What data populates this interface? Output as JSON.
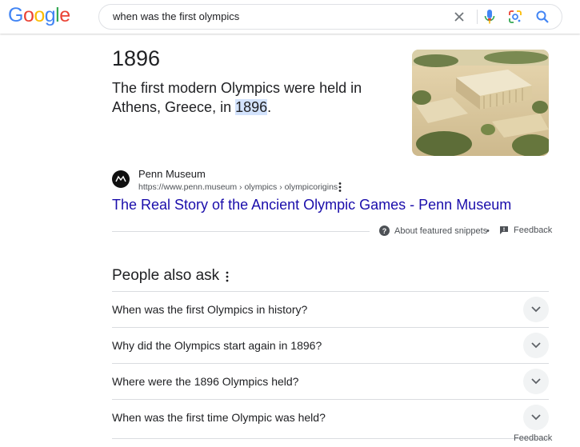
{
  "logo": {
    "letters": [
      "G",
      "o",
      "o",
      "g",
      "l",
      "e"
    ],
    "colors": [
      "#4285F4",
      "#EA4335",
      "#FBBC05",
      "#4285F4",
      "#34A853",
      "#EA4335"
    ]
  },
  "search": {
    "query": "when was the first olympics"
  },
  "featured": {
    "answer": "1896",
    "snippet_before": "The first modern Olympics were held in Athens, Greece, in ",
    "snippet_highlight": "1896",
    "snippet_after": ".",
    "source_name": "Penn Museum",
    "source_url": "https://www.penn.museum › olympics › olympicorigins",
    "link_title": "The Real Story of the Ancient Olympic Games - Penn Museum",
    "about_label": "About featured snippets",
    "dot": "•",
    "feedback_label": "Feedback"
  },
  "paa": {
    "title": "People also ask",
    "questions": [
      "When was the first Olympics in history?",
      "Why did the Olympics start again in 1896?",
      "Where were the 1896 Olympics held?",
      "When was the first time Olympic was held?"
    ],
    "feedback_label": "Feedback"
  },
  "colors": {
    "link": "#1a0dab",
    "highlight": "#d3e3fd",
    "accent_blue": "#1a73e8"
  }
}
